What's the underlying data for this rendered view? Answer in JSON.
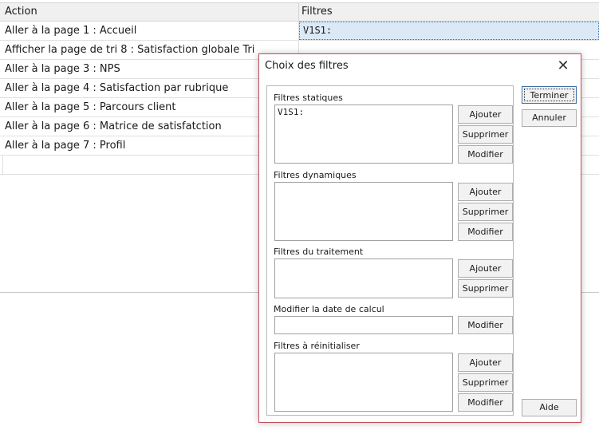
{
  "grid": {
    "headers": {
      "action": "Action",
      "filters": "Filtres"
    },
    "rows": [
      {
        "action": "Aller à la page 1 : Accueil",
        "filters": "V1S1:"
      },
      {
        "action": "Afficher la page de tri 8 : Satisfaction globale Tri",
        "filters": ""
      },
      {
        "action": "Aller à la page 3 : NPS",
        "filters": ""
      },
      {
        "action": "Aller à la page 4 : Satisfaction par rubrique",
        "filters": ""
      },
      {
        "action": "Aller à la page 5 : Parcours client",
        "filters": ""
      },
      {
        "action": "Aller à la page 6 : Matrice de satisfatction",
        "filters": ""
      },
      {
        "action": "Aller à la page 7 : Profil",
        "filters": ""
      }
    ]
  },
  "dialog": {
    "title": "Choix des filtres",
    "close_glyph": "✕",
    "sections": {
      "static": {
        "label": "Filtres statiques",
        "items": "V1S1:",
        "add": "Ajouter",
        "remove": "Supprimer",
        "modify": "Modifier"
      },
      "dynamic": {
        "label": "Filtres dynamiques",
        "items": "",
        "add": "Ajouter",
        "remove": "Supprimer",
        "modify": "Modifier"
      },
      "processing": {
        "label": "Filtres du traitement",
        "items": "",
        "add": "Ajouter",
        "remove": "Supprimer"
      },
      "calc_date": {
        "label": "Modifier la date de calcul",
        "value": "",
        "modify": "Modifier"
      },
      "reset": {
        "label": "Filtres à réinitialiser",
        "items": "",
        "add": "Ajouter",
        "remove": "Supprimer",
        "modify": "Modifier"
      }
    },
    "buttons": {
      "finish": "Terminer",
      "cancel": "Annuler",
      "help": "Aide"
    }
  }
}
